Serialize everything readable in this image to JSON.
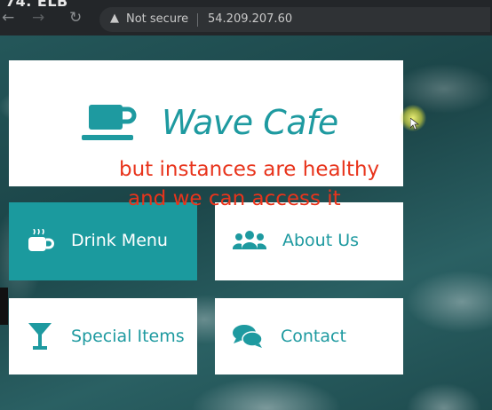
{
  "video": {
    "title": "74. ELB"
  },
  "browser": {
    "security_label": "Not secure",
    "host": "54.209.207.60"
  },
  "site": {
    "brand": "Wave Cafe",
    "tiles": [
      {
        "label": "Drink Menu",
        "icon": "coffee-cup-icon"
      },
      {
        "label": "About Us",
        "icon": "users-icon"
      },
      {
        "label": "Special Items",
        "icon": "cocktail-icon"
      },
      {
        "label": "Contact",
        "icon": "comments-icon"
      }
    ]
  },
  "caption": {
    "line1": "but instances are healthy",
    "line2": "and we can access it"
  },
  "colors": {
    "accent": "#1e9aa0",
    "caption": "#e8341c",
    "chrome": "#232629"
  }
}
